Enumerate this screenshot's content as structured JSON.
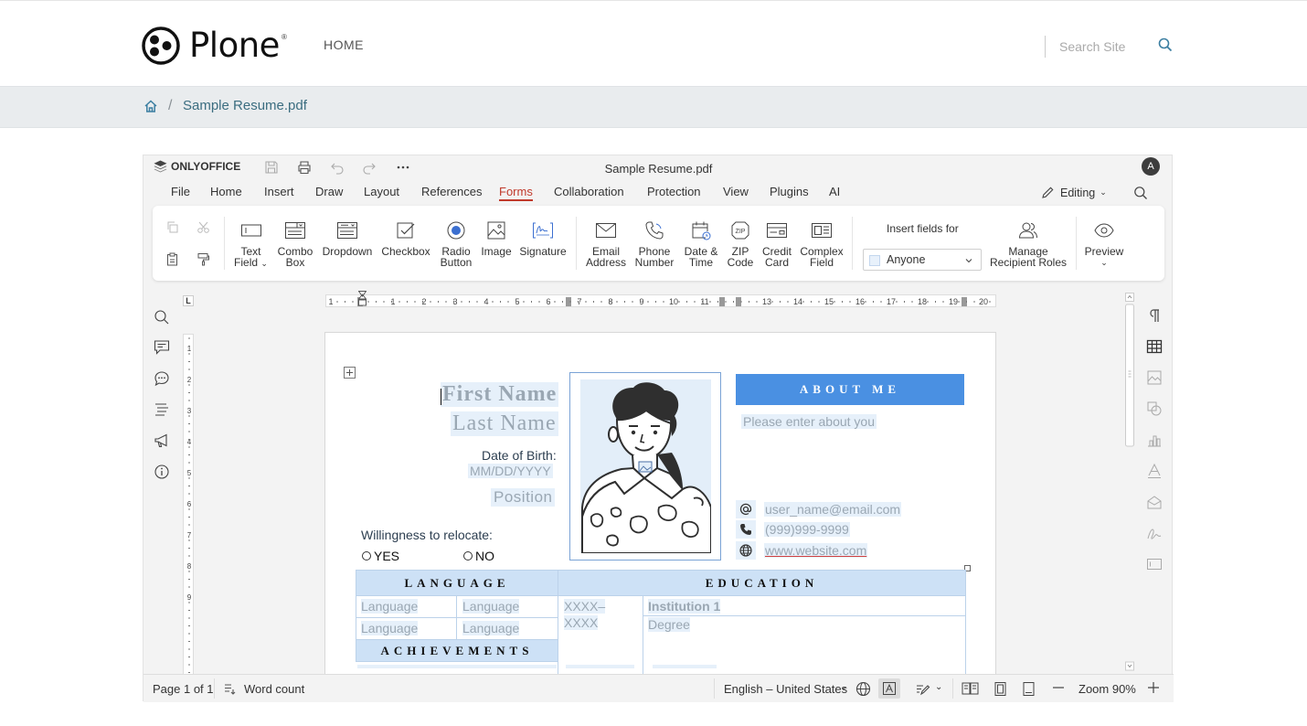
{
  "site": {
    "logo_text": "Plone",
    "nav_home": "HOME",
    "search_placeholder": "Search Site"
  },
  "breadcrumb": {
    "file": "Sample Resume.pdf",
    "separator": "/"
  },
  "editor": {
    "brand": "ONLYOFFICE",
    "doc_title": "Sample Resume.pdf",
    "avatar": "A",
    "tabs": [
      "File",
      "Home",
      "Insert",
      "Draw",
      "Layout",
      "References",
      "Forms",
      "Collaboration",
      "Protection",
      "View",
      "Plugins",
      "AI"
    ],
    "active_tab": "Forms",
    "mode": "Editing",
    "ribbon": {
      "text_field": [
        "Text",
        "Field"
      ],
      "combo_box": [
        "Combo",
        "Box"
      ],
      "dropdown": "Dropdown",
      "checkbox": "Checkbox",
      "radio_button": [
        "Radio",
        "Button"
      ],
      "image": "Image",
      "signature": "Signature",
      "email_address": [
        "Email",
        "Address"
      ],
      "phone_number": [
        "Phone",
        "Number"
      ],
      "date_time": [
        "Date &",
        "Time"
      ],
      "zip_code": [
        "ZIP",
        "Code"
      ],
      "credit_card": [
        "Credit",
        "Card"
      ],
      "complex_field": [
        "Complex",
        "Field"
      ],
      "insert_fields_for": "Insert fields for",
      "recipient": "Anyone",
      "manage_roles": [
        "Manage",
        "Recipient Roles"
      ],
      "preview": "Preview"
    },
    "ruler_numbers": [
      "1",
      "1",
      "2",
      "3",
      "4",
      "5",
      "6",
      "7",
      "8",
      "9",
      "10",
      "11",
      "13",
      "14",
      "15",
      "16",
      "17",
      "18",
      "19",
      "20"
    ],
    "ruler_v_numbers": [
      "1",
      "2",
      "3",
      "4",
      "5",
      "6",
      "7",
      "8",
      "9"
    ]
  },
  "resume": {
    "first_name": "First Name",
    "last_name": "Last Name",
    "dob_label": "Date of Birth:",
    "dob_value": "MM/DD/YYYY",
    "position": "Position",
    "relocate": "Willingness to relocate:",
    "yes": "YES",
    "no": "NO",
    "about_header": "ABOUT ME",
    "about_text": "Please enter about you",
    "email": "user_name@email.com",
    "phone": "(999)999-9999",
    "website": "www.website.com",
    "language_header": "LANGUAGE",
    "education_header": "EDUCATION",
    "achievements_header": "ACHIEVEMENTS",
    "lang_cells": [
      "Language",
      "Language",
      "Language",
      "Language"
    ],
    "edu_years": "XXXX–XXXX",
    "institution": "Institution 1",
    "degree": "Degree"
  },
  "status": {
    "page": "Page 1 of 1",
    "word_count": "Word count",
    "language": "English – United States",
    "zoom": "Zoom 90%"
  },
  "colors": {
    "accent_red": "#c0392b",
    "about_blue": "#4a90e2",
    "field_fill": "#e6f0fa",
    "header_fill": "#cde1f6"
  }
}
